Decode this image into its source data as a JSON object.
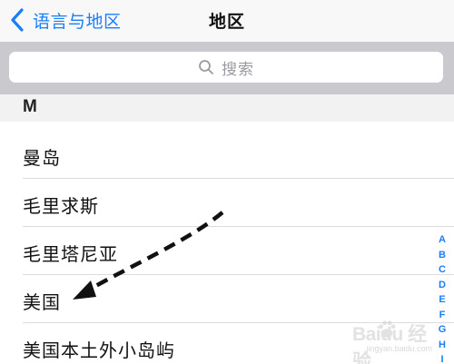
{
  "navbar": {
    "back_label": "语言与地区",
    "title": "地区",
    "back_icon": "chevron-left-icon"
  },
  "search": {
    "placeholder": "搜索",
    "icon": "search-icon"
  },
  "section": {
    "header": "M"
  },
  "list": {
    "items": [
      {
        "label": "曼岛"
      },
      {
        "label": "毛里求斯"
      },
      {
        "label": "毛里塔尼亚"
      },
      {
        "label": "美国"
      },
      {
        "label": "美国本土外小岛屿"
      }
    ]
  },
  "index": {
    "letters": [
      "A",
      "B",
      "C",
      "D",
      "E",
      "F",
      "G",
      "H",
      "I"
    ]
  },
  "watermark": {
    "brand": "Baidu 经验",
    "url": "jingyan.baidu.com"
  },
  "colors": {
    "accent": "#1a7ef7",
    "nav_bg": "#f8f8f8",
    "search_bg": "#c9c9ce",
    "section_bg": "#f2f2f2",
    "separator": "#dcdcdc",
    "annotation_arrow": "#111111"
  }
}
